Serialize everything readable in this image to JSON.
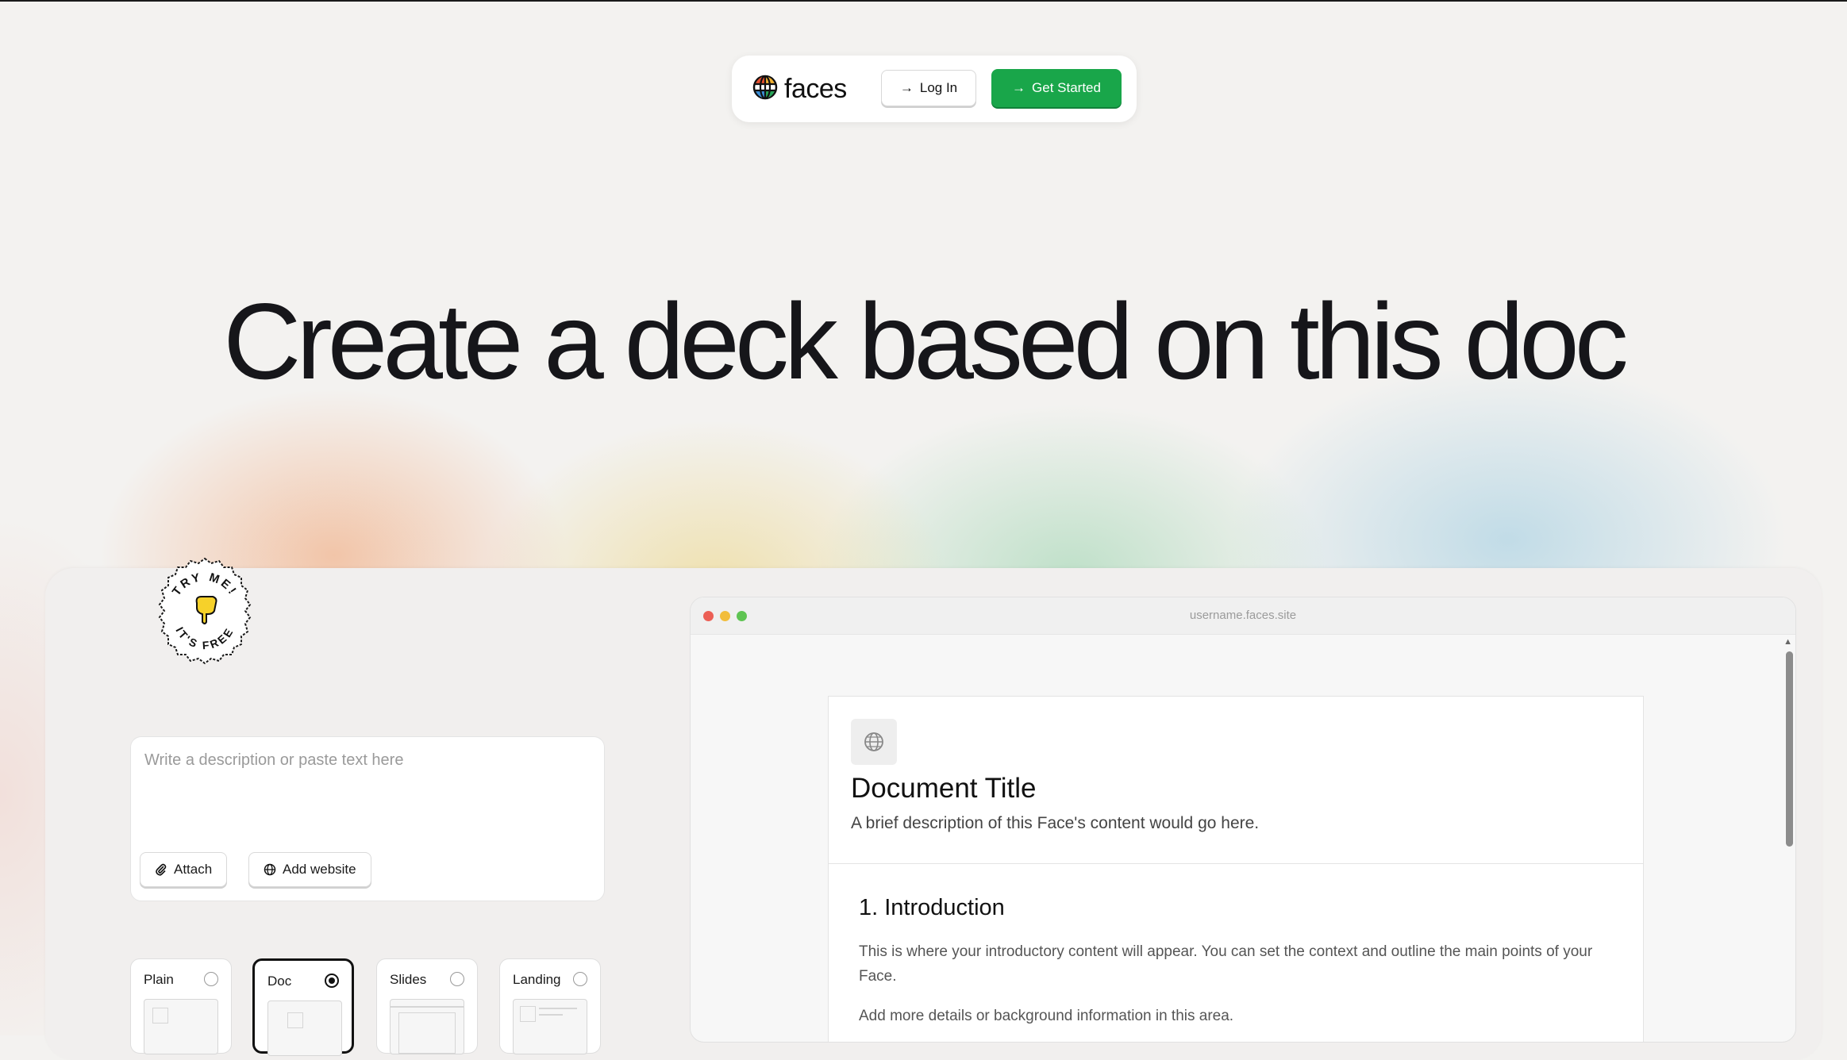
{
  "nav": {
    "logo_text": "faces",
    "login_label": "Log In",
    "get_started_label": "Get Started"
  },
  "hero": {
    "title": "Create a deck based on this doc"
  },
  "badge": {
    "top_text": "TRY ME!",
    "bottom_text": "IT'S FREE"
  },
  "input": {
    "placeholder": "Write a description or paste text here",
    "attach_label": "Attach",
    "add_website_label": "Add website"
  },
  "formats": [
    {
      "label": "Plain",
      "selected": false
    },
    {
      "label": "Doc",
      "selected": true
    },
    {
      "label": "Slides",
      "selected": false
    },
    {
      "label": "Landing",
      "selected": false
    }
  ],
  "preview": {
    "url": "username.faces.site",
    "doc_title": "Document Title",
    "doc_description": "A brief description of this Face's content would go here.",
    "section_title": "1. Introduction",
    "section_p1": "This is where your introductory content will appear. You can set the context and outline the main points of your Face.",
    "section_p2": "Add more details or background information in this area."
  },
  "colors": {
    "accent_green": "#19a64a",
    "traffic_red": "#ec5f55",
    "traffic_yellow": "#f2bd3b",
    "traffic_green": "#5fc453"
  }
}
